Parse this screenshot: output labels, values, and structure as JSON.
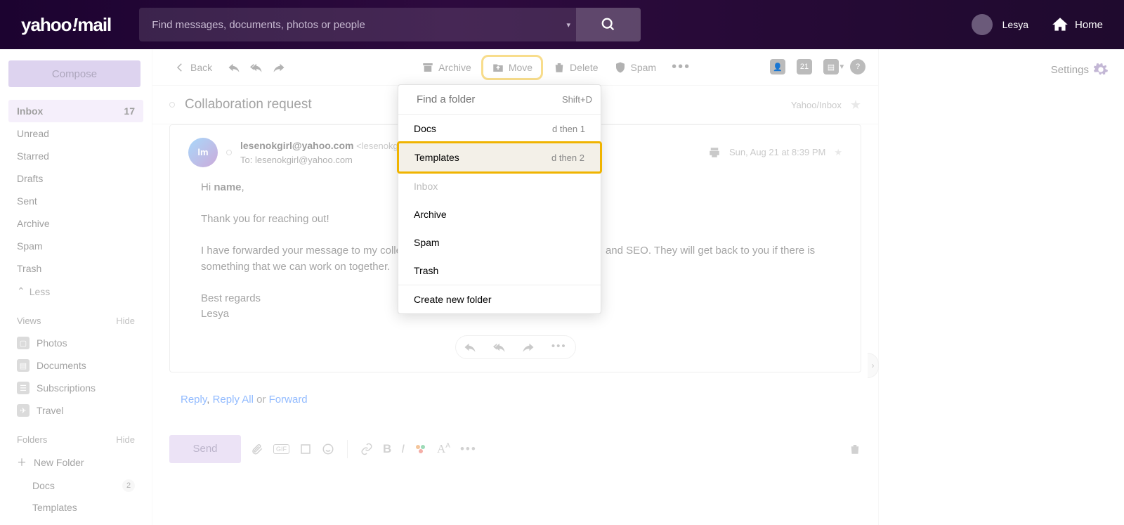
{
  "header": {
    "logo_text": "yahoo!mail",
    "search_placeholder": "Find messages, documents, photos or people",
    "user_name": "Lesya",
    "home_label": "Home"
  },
  "sidebar": {
    "compose_label": "Compose",
    "nav": [
      {
        "label": "Inbox",
        "count": "17",
        "active": true
      },
      {
        "label": "Unread"
      },
      {
        "label": "Starred"
      },
      {
        "label": "Drafts"
      },
      {
        "label": "Sent"
      },
      {
        "label": "Archive"
      },
      {
        "label": "Spam"
      },
      {
        "label": "Trash"
      }
    ],
    "less_label": "Less",
    "views_label": "Views",
    "views_hide": "Hide",
    "views": [
      {
        "label": "Photos"
      },
      {
        "label": "Documents"
      },
      {
        "label": "Subscriptions"
      },
      {
        "label": "Travel"
      }
    ],
    "folders_label": "Folders",
    "folders_hide": "Hide",
    "new_folder_label": "New Folder",
    "folders": [
      {
        "label": "Docs",
        "count": "2"
      },
      {
        "label": "Templates"
      }
    ]
  },
  "toolbar": {
    "back": "Back",
    "archive": "Archive",
    "move": "Move",
    "delete": "Delete",
    "spam": "Spam"
  },
  "message": {
    "subject": "Collaboration request",
    "location": "Yahoo/Inbox",
    "from_name": "lesenokgirl@yahoo.com",
    "from_email": "<lesenokgirl@yahoo",
    "to_line": "To: lesenokgirl@yahoo.com",
    "date": "Sun, Aug 21 at 8:39 PM",
    "avatar_initials": "lm",
    "body_greeting": "Hi ",
    "body_name": "name",
    "body_greeting_comma": ",",
    "body_p1": "Thank you for reaching out!",
    "body_p2_a": "I have forwarded your message to my colle",
    "body_p2_b": "and SEO. They will get back to you if there is something that we can work on together.",
    "body_signoff1": "Best regards",
    "body_signoff2": "Lesya"
  },
  "reply_links": {
    "reply": "Reply",
    "reply_all": "Reply All",
    "or": " or ",
    "forward": "Forward"
  },
  "composer": {
    "send": "Send"
  },
  "dropdown": {
    "search_placeholder": "Find a folder",
    "search_shortcut": "Shift+D",
    "items": [
      {
        "label": "Docs",
        "shortcut": "d then 1"
      },
      {
        "label": "Templates",
        "shortcut": "d then 2",
        "highlighted": true
      },
      {
        "label": "Inbox",
        "disabled": true
      },
      {
        "label": "Archive"
      },
      {
        "label": "Spam"
      },
      {
        "label": "Trash"
      }
    ],
    "create_label": "Create new folder"
  },
  "right_rail": {
    "settings": "Settings",
    "calendar_day": "21"
  }
}
